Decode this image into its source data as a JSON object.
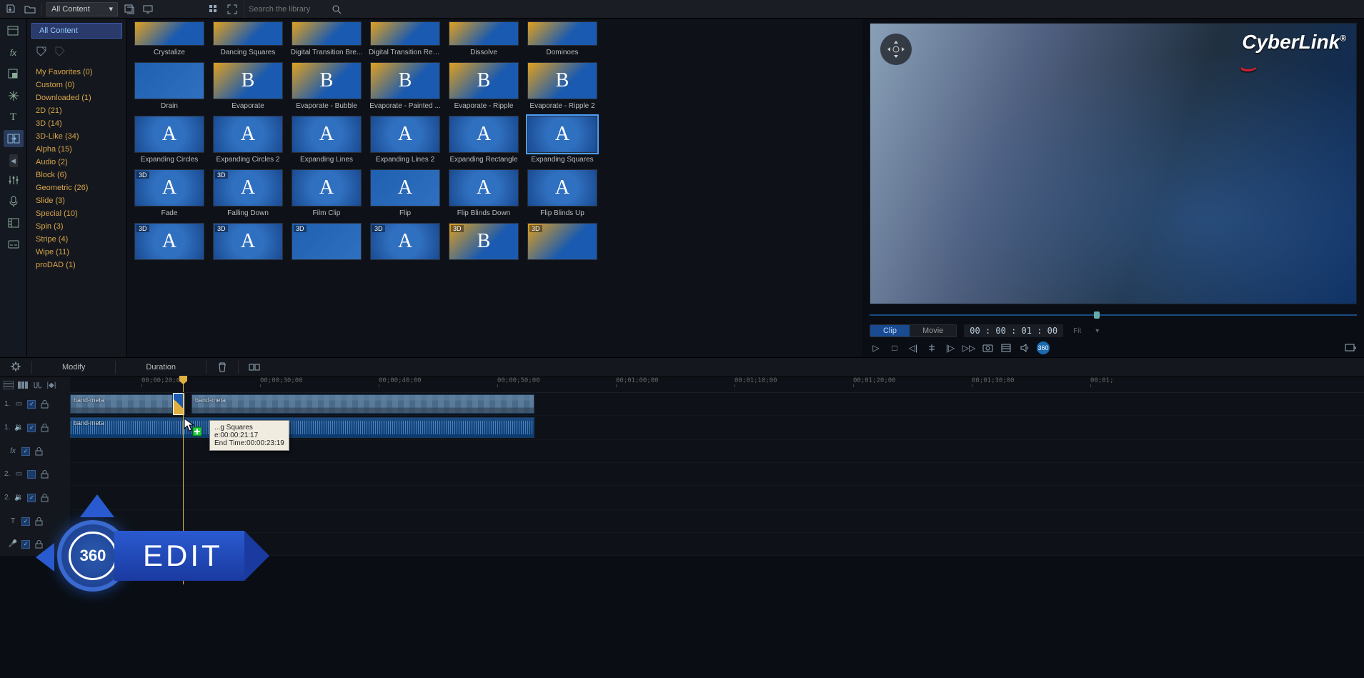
{
  "topbar": {
    "content_filter": "All Content",
    "search_placeholder": "Search the library"
  },
  "sidebar": {
    "header": "All Content",
    "categories": [
      {
        "label": "My Favorites",
        "count": "(0)"
      },
      {
        "label": "Custom",
        "count": "(0)"
      },
      {
        "label": "Downloaded",
        "count": "(1)"
      },
      {
        "label": "2D",
        "count": "(21)"
      },
      {
        "label": "3D",
        "count": "(14)"
      },
      {
        "label": "3D-Like",
        "count": "(34)"
      },
      {
        "label": "Alpha",
        "count": "(15)"
      },
      {
        "label": "Audio",
        "count": "(2)"
      },
      {
        "label": "Block",
        "count": "(6)"
      },
      {
        "label": "Geometric",
        "count": "(26)"
      },
      {
        "label": "Slide",
        "count": "(3)"
      },
      {
        "label": "Special",
        "count": "(10)"
      },
      {
        "label": "Spin",
        "count": "(3)"
      },
      {
        "label": "Stripe",
        "count": "(4)"
      },
      {
        "label": "Wipe",
        "count": "(11)"
      },
      {
        "label": "proDAD",
        "count": "(1)"
      }
    ]
  },
  "library": {
    "items": [
      {
        "label": "Crystalize",
        "letter": "",
        "style": "part"
      },
      {
        "label": "Dancing Squares",
        "letter": "",
        "style": "part"
      },
      {
        "label": "Digital Transition Bre...",
        "letter": "",
        "style": "part"
      },
      {
        "label": "Digital Transition Res...",
        "letter": "",
        "style": "part"
      },
      {
        "label": "Dissolve",
        "letter": "",
        "style": "part"
      },
      {
        "label": "Dominoes",
        "letter": "",
        "style": "part"
      },
      {
        "label": "Drain",
        "letter": "",
        "style": "blue"
      },
      {
        "label": "Evaporate",
        "letter": "B",
        "style": ""
      },
      {
        "label": "Evaporate - Bubble",
        "letter": "B",
        "style": ""
      },
      {
        "label": "Evaporate - Painted ...",
        "letter": "B",
        "style": ""
      },
      {
        "label": "Evaporate - Ripple",
        "letter": "B",
        "style": ""
      },
      {
        "label": "Evaporate - Ripple 2",
        "letter": "B",
        "style": ""
      },
      {
        "label": "Expanding Circles",
        "letter": "A",
        "style": "blueA"
      },
      {
        "label": "Expanding Circles 2",
        "letter": "A",
        "style": "blueA"
      },
      {
        "label": "Expanding Lines",
        "letter": "A",
        "style": "blueA"
      },
      {
        "label": "Expanding Lines 2",
        "letter": "A",
        "style": "blueA"
      },
      {
        "label": "Expanding Rectangle",
        "letter": "A",
        "style": "blueA"
      },
      {
        "label": "Expanding Squares",
        "letter": "A",
        "style": "blueA",
        "selected": true
      },
      {
        "label": "Fade",
        "letter": "A",
        "style": "blueA",
        "tag3d": "3D"
      },
      {
        "label": "Falling Down",
        "letter": "A",
        "style": "blueA",
        "tag3d": "3D"
      },
      {
        "label": "Film Clip",
        "letter": "A",
        "style": "blueA"
      },
      {
        "label": "Flip",
        "letter": "A",
        "style": "blue"
      },
      {
        "label": "Flip Blinds Down",
        "letter": "A",
        "style": "blueA"
      },
      {
        "label": "Flip Blinds Up",
        "letter": "A",
        "style": "blueA"
      },
      {
        "label": "",
        "letter": "A",
        "style": "blueA",
        "tag3d": "3D"
      },
      {
        "label": "",
        "letter": "A",
        "style": "blueA",
        "tag3d": "3D"
      },
      {
        "label": "",
        "letter": "",
        "style": "blue",
        "tag3d": "3D"
      },
      {
        "label": "",
        "letter": "A",
        "style": "blueA",
        "tag3d": "3D"
      },
      {
        "label": "",
        "letter": "B",
        "style": "",
        "tag3d": "3D"
      },
      {
        "label": "",
        "letter": "",
        "style": "",
        "tag3d": "3D"
      }
    ]
  },
  "preview": {
    "brand": "CyberLink",
    "clip_tab": "Clip",
    "movie_tab": "Movie",
    "timecode": "00 : 00 : 01 : 00",
    "fit": "Fit"
  },
  "toolrow": {
    "modify": "Modify",
    "duration": "Duration"
  },
  "timeline": {
    "ruler": [
      "00;00;20;00",
      "00;00;30;00",
      "00;00;40;00",
      "00;00;50;00",
      "00;01;00;00",
      "00;01;10;00",
      "00;01;20;00",
      "00;01;30;00",
      "00;01;"
    ],
    "tracks": [
      {
        "num": "1.",
        "icon": "video",
        "chk": true,
        "lock": true
      },
      {
        "num": "1.",
        "icon": "audio",
        "chk": true,
        "lock": true
      },
      {
        "num": "",
        "icon": "fx",
        "chk": true,
        "lock": true
      },
      {
        "num": "2.",
        "icon": "video",
        "chk": false,
        "lock": true
      },
      {
        "num": "2.",
        "icon": "audio",
        "chk": true,
        "lock": true
      },
      {
        "num": "",
        "icon": "title",
        "chk": true,
        "lock": true
      },
      {
        "num": "",
        "icon": "voice",
        "chk": true,
        "lock": true
      }
    ],
    "clips": {
      "v1a": {
        "label": "band-meta"
      },
      "v1b": {
        "label": "band-meta"
      },
      "a1": {
        "label": "band-meta"
      }
    },
    "tooltip": {
      "name": "...g Squares",
      "start": "e:00:00:21:17",
      "end": "End Time:00:00:23:19"
    }
  },
  "overlay": {
    "badge_num": "360",
    "badge_text": "EDIT"
  }
}
